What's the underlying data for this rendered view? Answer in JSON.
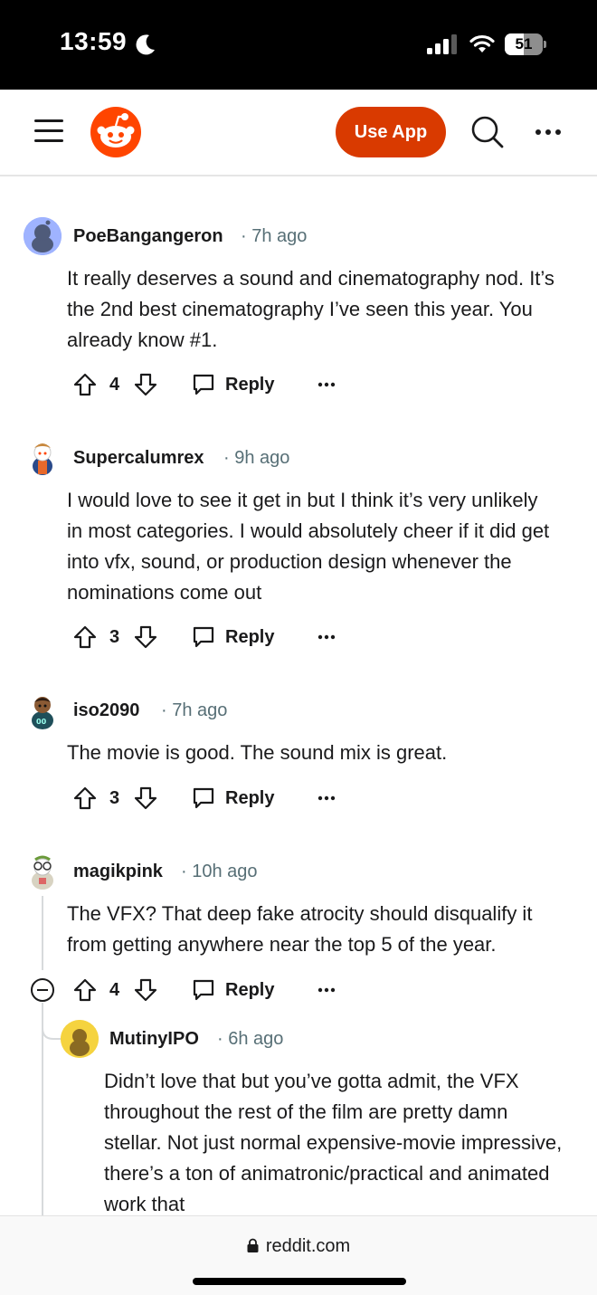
{
  "status_bar": {
    "time": "13:59",
    "battery": "51",
    "battery_percent": 51
  },
  "header": {
    "use_app_label": "Use App"
  },
  "comments": [
    {
      "author": "PoeBangangeron",
      "time": "7h ago",
      "body": "It really deserves a sound and cinematography nod. It’s the 2nd best cinematography I’ve seen this year. You already know #1.",
      "votes": "4",
      "reply_label": "Reply",
      "avatar_color": "#7193ff"
    },
    {
      "author": "Supercalumrex",
      "time": "9h ago",
      "body": "I would love to see it get in but I think it’s very unlikely in most categories. I would absolutely cheer if it did get into vfx, sound, or production design whenever the nominations come out",
      "votes": "3",
      "reply_label": "Reply",
      "avatar_color": "#ffffff"
    },
    {
      "author": "iso2090",
      "time": "7h ago",
      "body": "The movie is good. The sound mix is great.",
      "votes": "3",
      "reply_label": "Reply",
      "avatar_color": "#ffffff"
    },
    {
      "author": "magikpink",
      "time": "10h ago",
      "body": "The VFX? That deep fake atrocity should disqualify it from getting anywhere near the top 5 of the year.",
      "votes": "4",
      "reply_label": "Reply",
      "avatar_color": "#ffffff"
    },
    {
      "author": "MutinyIPO",
      "time": "6h ago",
      "body": "Didn’t love that but you’ve gotta admit, the VFX throughout the rest of the film are pretty damn stellar. Not just normal expensive-movie impressive, there’s a ton of animatronic/practical and animated work that",
      "avatar_color": "#f5d33f"
    }
  ],
  "bottom_bar": {
    "url": "reddit.com"
  },
  "colors": {
    "accent": "#d93a00",
    "reddit_orange": "#ff4500",
    "meta_text": "#576f76"
  }
}
